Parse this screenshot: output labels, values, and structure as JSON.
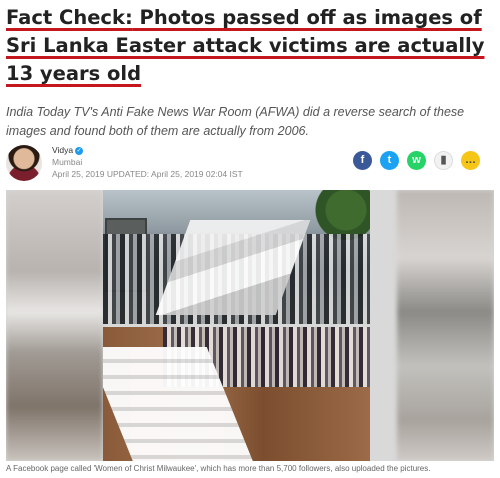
{
  "article": {
    "headline_label": "Fact Check:",
    "headline_text": "Photos passed off as images of Sri Lanka Easter attack victims are actually 13 years old",
    "summary": "India Today TV's Anti Fake News War Room (AFWA) did a reverse search of these images and found both of them are actually from 2006.",
    "author": "Vidya",
    "location": "Mumbai",
    "dates": "April 25, 2019 UPDATED: April 25, 2019 02:04 IST",
    "caption": "A Facebook page called 'Women of Christ Milwaukee', which has more than 5,700 followers, also uploaded the pictures."
  },
  "share": {
    "facebook": "f",
    "twitter": "t",
    "whatsapp": "w",
    "bookmark": "▮",
    "comment": "…"
  },
  "colors": {
    "underline": "#c4161c",
    "facebook": "#3b5998",
    "twitter": "#1da1f2",
    "whatsapp": "#25d366",
    "comment": "#f5c518"
  }
}
